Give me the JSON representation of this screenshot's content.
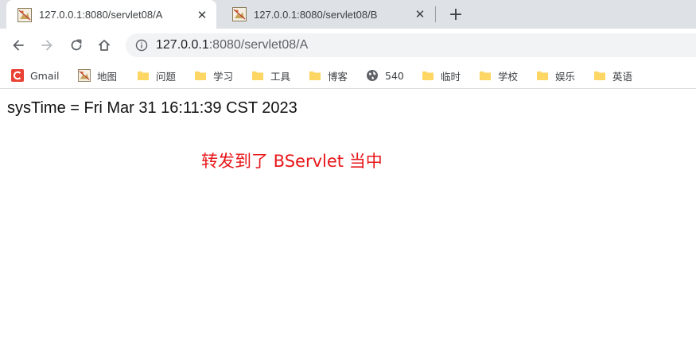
{
  "tabs": [
    {
      "title": "127.0.0.1:8080/servlet08/A",
      "active": true,
      "close_glyph": "✕",
      "favicon": "image-favicon-icon"
    },
    {
      "title": "127.0.0.1:8080/servlet08/B",
      "active": false,
      "close_glyph": "✕",
      "favicon": "image-favicon-icon"
    }
  ],
  "new_tab_glyph": "+",
  "toolbar": {
    "back_icon": "back-arrow-icon",
    "forward_icon": "forward-arrow-icon",
    "reload_icon": "reload-icon",
    "home_icon": "home-icon",
    "omnibox": {
      "host": "127.0.0.1",
      "rest": ":8080/servlet08/A",
      "info_icon": "info-icon"
    }
  },
  "bookmarks": [
    {
      "label": "Gmail",
      "icon": "gmail-icon"
    },
    {
      "label": "地图",
      "icon": "image-favicon-icon"
    },
    {
      "label": "问题",
      "icon": "folder-icon"
    },
    {
      "label": "学习",
      "icon": "folder-icon"
    },
    {
      "label": "工具",
      "icon": "folder-icon"
    },
    {
      "label": "博客",
      "icon": "folder-icon"
    },
    {
      "label": "540",
      "icon": "globe-icon"
    },
    {
      "label": "临时",
      "icon": "folder-icon"
    },
    {
      "label": "学校",
      "icon": "folder-icon"
    },
    {
      "label": "娱乐",
      "icon": "folder-icon"
    },
    {
      "label": "英语",
      "icon": "folder-icon"
    }
  ],
  "page": {
    "systime_line": "sysTime = Fri Mar 31 16:11:39 CST 2023",
    "forward_message": "转发到了 BServlet 当中"
  },
  "colors": {
    "tabstrip_bg": "#dee1e6",
    "omnibox_bg": "#f1f3f4",
    "forward_message_color": "#e8171b",
    "folder_yellow": "#fdd663",
    "gmail_red": "#ea4335"
  }
}
